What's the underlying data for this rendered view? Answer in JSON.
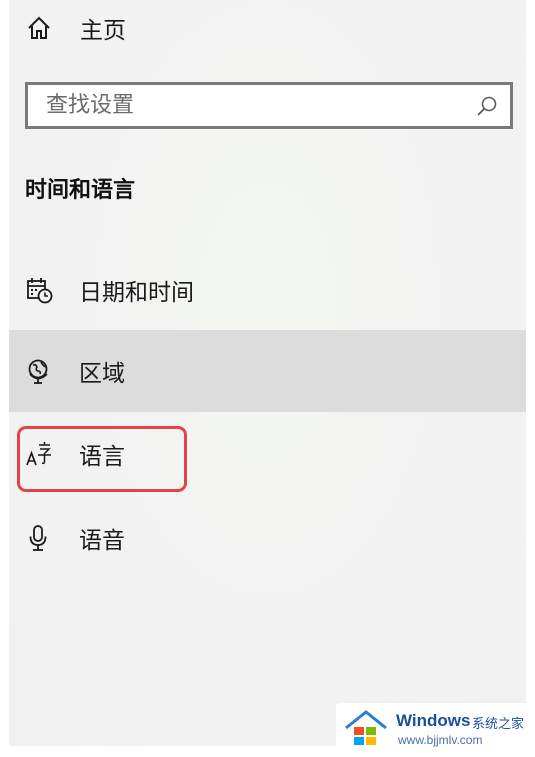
{
  "nav": {
    "home_label": "主页"
  },
  "search": {
    "placeholder": "查找设置"
  },
  "section": {
    "title": "时间和语言"
  },
  "items": [
    {
      "label": "日期和时间",
      "icon": "calendar-clock-icon",
      "selected": false
    },
    {
      "label": "区域",
      "icon": "globe-region-icon",
      "selected": true
    },
    {
      "label": "语言",
      "icon": "language-icon",
      "selected": false
    },
    {
      "label": "语音",
      "icon": "microphone-icon",
      "selected": false
    }
  ],
  "colors": {
    "panel_bg": "#f2f2f2",
    "selected_bg": "#dcdcdc",
    "highlight_border": "#e0434a",
    "search_border": "#7a7a7a"
  },
  "watermark": {
    "brand": "Windows",
    "brand_cn": "系统之家",
    "url": "www.bjjmlv.com"
  }
}
